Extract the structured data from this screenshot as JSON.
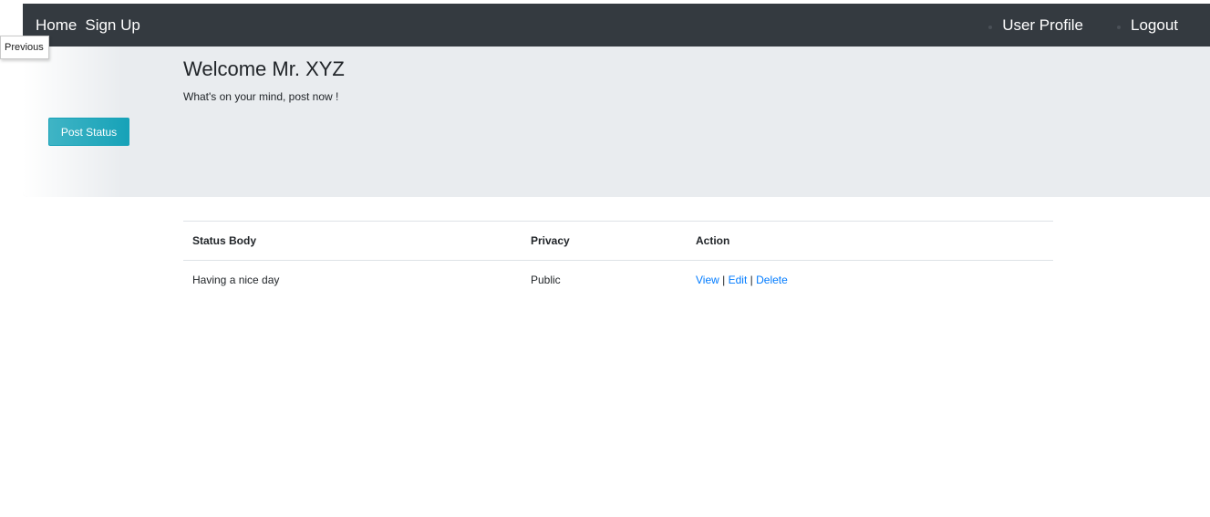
{
  "nav": {
    "home": "Home",
    "signup": "Sign Up",
    "profile": "User Profile",
    "logout": "Logout"
  },
  "tooltip": "Previous",
  "jumbotron": {
    "title": "Welcome Mr. XYZ",
    "subtitle": "What's on your mind, post now !",
    "post_button": "Post Status"
  },
  "table": {
    "headers": [
      "Status Body",
      "Privacy",
      "Action"
    ],
    "rows": [
      {
        "body": "Having a nice day",
        "privacy": "Public",
        "actions": [
          "View",
          "Edit",
          "Delete"
        ]
      }
    ],
    "separator": "|"
  },
  "colors": {
    "navbar": "#343a40",
    "jumbotron": "#e9ecef",
    "button": "#17a2b8",
    "link": "#007bff"
  }
}
